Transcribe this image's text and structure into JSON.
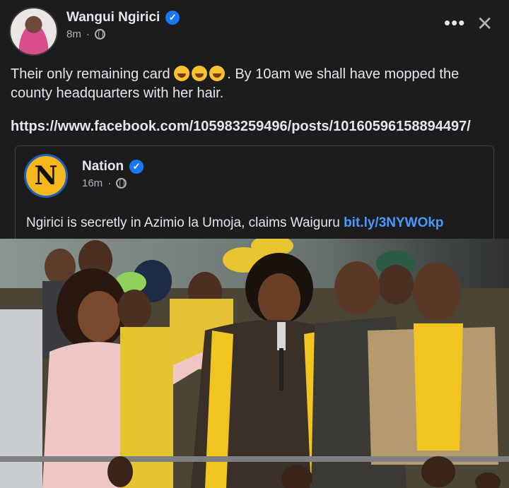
{
  "post": {
    "author": "Wangui Ngirici",
    "verified_mark": "✓",
    "time": "8m",
    "more_icon": "•••",
    "close_icon": "✕",
    "text_before": "Their only remaining card ",
    "text_after": ". By 10am we shall have mopped the county headquarters with her hair.",
    "url": "https://www.facebook.com/105983259496/posts/10160596158894497/"
  },
  "shared": {
    "logo_letter": "N",
    "page": "Nation",
    "time": "16m",
    "text": "Ngirici is secretly in Azimio la Umoja, claims Waiguru ",
    "link": "bit.ly/3NYWOkp"
  },
  "colors": {
    "background": "#1c1c1d",
    "text": "#e4e6eb",
    "muted": "#b0b3b8",
    "link": "#4599ff",
    "verified": "#1877f2"
  }
}
